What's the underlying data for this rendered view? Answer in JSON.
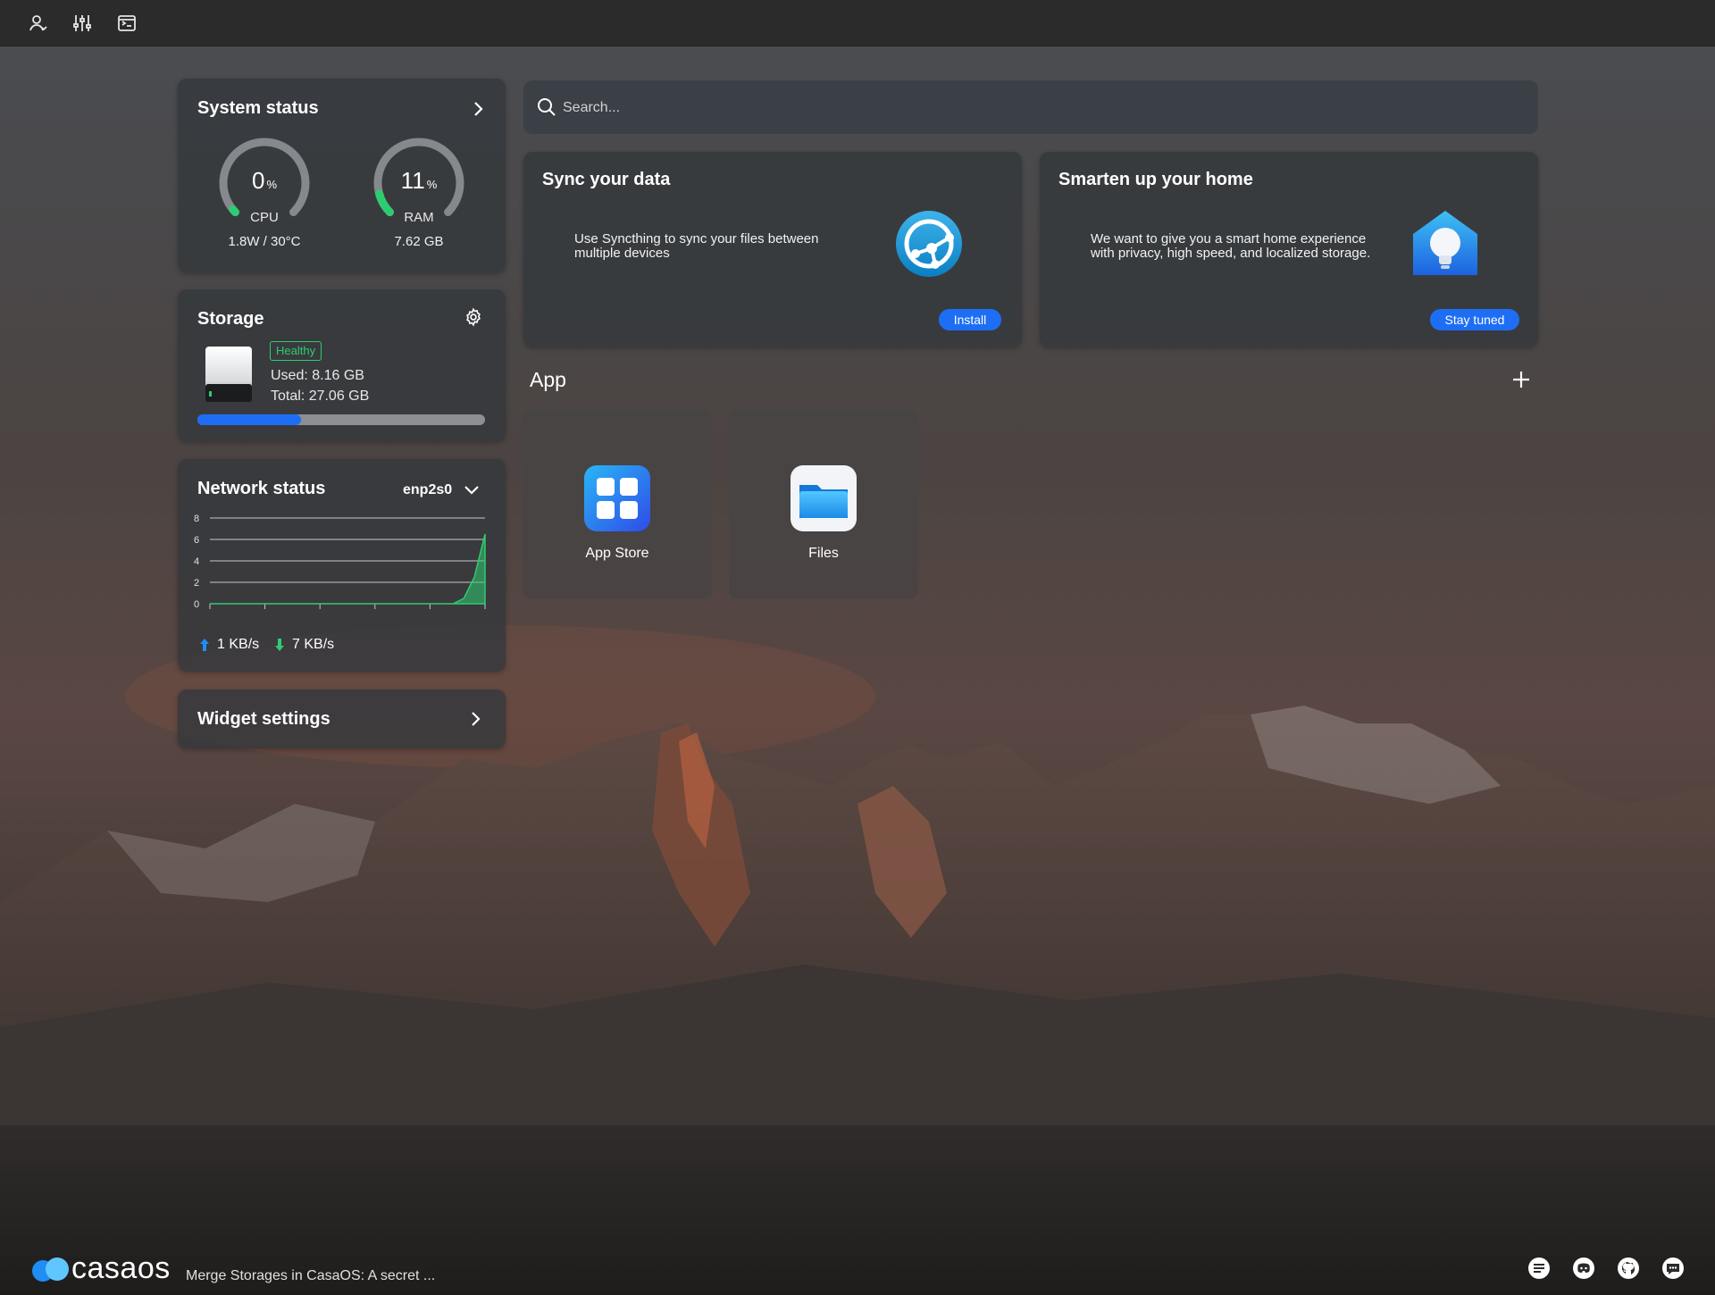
{
  "topbar": {
    "icons": [
      "account-icon",
      "settings-sliders-icon",
      "terminal-icon"
    ]
  },
  "system_status": {
    "title": "System status",
    "cpu": {
      "value": "0",
      "unit": "%",
      "label": "CPU",
      "detail": "1.8W / 30°C",
      "percent": 0
    },
    "ram": {
      "value": "11",
      "unit": "%",
      "label": "RAM",
      "detail": "7.62 GB",
      "percent": 11
    },
    "accent_color": "#2ecc71"
  },
  "storage": {
    "title": "Storage",
    "badge": "Healthy",
    "used": "Used: 8.16 GB",
    "total": "Total: 27.06 GB",
    "used_fraction": 0.36,
    "bar_color": "#1e6ef5"
  },
  "network": {
    "title": "Network status",
    "interface": "enp2s0",
    "upload": "1 KB/s",
    "download": "7 KB/s",
    "chart_data": {
      "type": "area",
      "y_ticks": [
        "8",
        "6",
        "4",
        "2",
        "0"
      ],
      "ylim": [
        0,
        8
      ],
      "series": [
        {
          "values": [
            0,
            0,
            0,
            0,
            0,
            0,
            0,
            0,
            0,
            0,
            0,
            0,
            0,
            0,
            0,
            0,
            0,
            0,
            0,
            0,
            0,
            0,
            0,
            0,
            0.5,
            2.5,
            6.5
          ]
        }
      ],
      "colors": [
        "#2ecc71",
        "#1e6ef5"
      ]
    }
  },
  "widget_settings": {
    "title": "Widget settings"
  },
  "search": {
    "placeholder": "Search..."
  },
  "cards": [
    {
      "title": "Sync your data",
      "text_line1": "Use Syncthing to sync your files between",
      "text_line2": "multiple devices",
      "button": "Install",
      "icon": "syncthing-icon"
    },
    {
      "title": "Smarten up your home",
      "text_line1": "We want to give you a smart home experience",
      "text_line2": "with privacy, high speed, and localized storage.",
      "button": "Stay tuned",
      "icon": "smart-home-icon"
    }
  ],
  "apps": {
    "title": "App",
    "items": [
      {
        "name": "App Store",
        "icon": "app-store-icon"
      },
      {
        "name": "Files",
        "icon": "files-icon"
      }
    ]
  },
  "footer": {
    "logo_text": "casaos",
    "news": "Merge Storages in CasaOS: A secret ...",
    "icons": [
      "feedback-icon",
      "discord-icon",
      "github-icon",
      "chat-icon"
    ]
  }
}
